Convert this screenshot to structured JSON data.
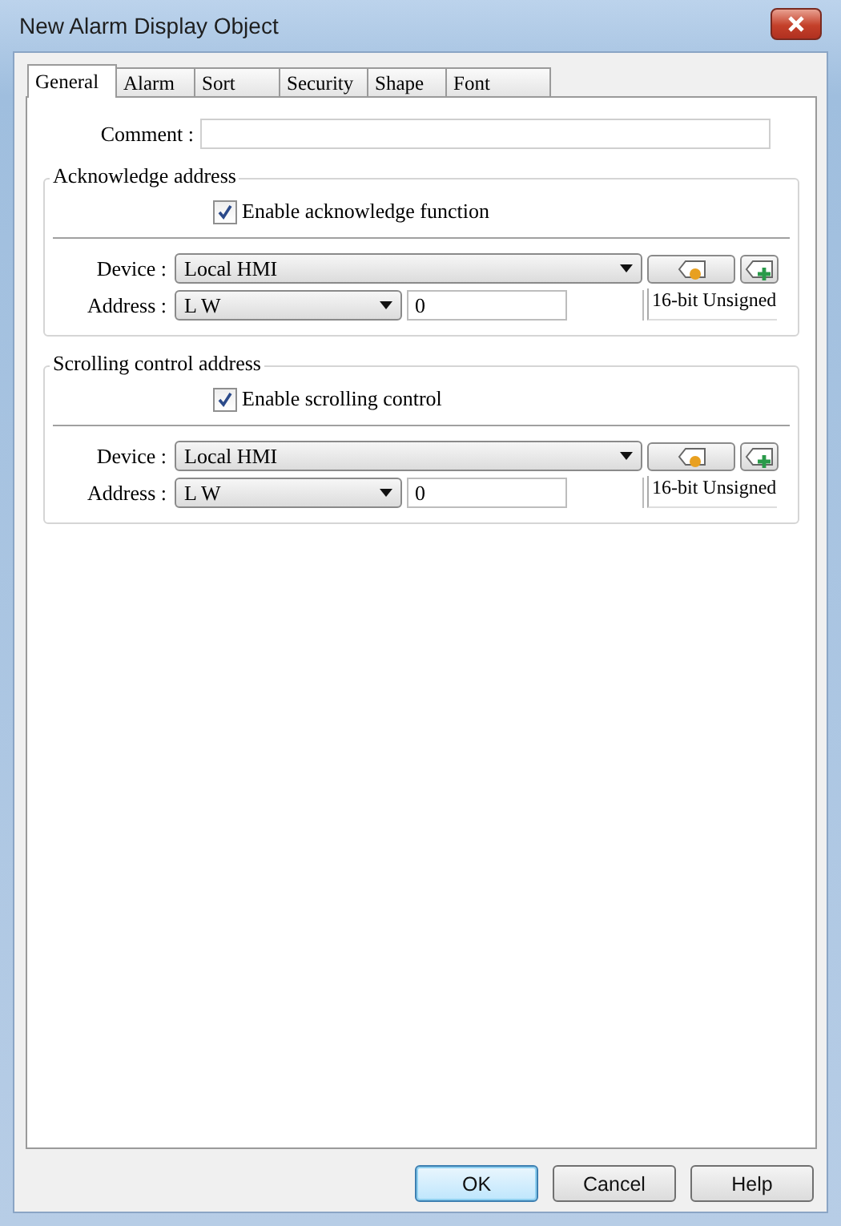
{
  "window": {
    "title": "New Alarm Display Object"
  },
  "tabs": [
    {
      "label": "General",
      "selected": true
    },
    {
      "label": "Alarm",
      "selected": false
    },
    {
      "label": "Sort",
      "selected": false
    },
    {
      "label": "Security",
      "selected": false
    },
    {
      "label": "Shape",
      "selected": false
    },
    {
      "label": "Font",
      "selected": false
    }
  ],
  "comment": {
    "label": "Comment :"
  },
  "sections": [
    {
      "title": "Acknowledge address",
      "checkbox": {
        "label": "Enable acknowledge function",
        "checked": true
      },
      "device": {
        "label": "Device :",
        "value": "Local HMI"
      },
      "address": {
        "label": "Address :",
        "register": "L W",
        "value": "0",
        "type": "16-bit Unsigned"
      }
    },
    {
      "title": "Scrolling control address",
      "checkbox": {
        "label": "Enable scrolling control",
        "checked": true
      },
      "device": {
        "label": "Device :",
        "value": "Local HMI"
      },
      "address": {
        "label": "Address :",
        "register": "L W",
        "value": "0",
        "type": "16-bit Unsigned"
      }
    }
  ],
  "buttons": [
    {
      "label": "OK",
      "default": true
    },
    {
      "label": "Cancel",
      "default": false
    },
    {
      "label": "Help",
      "default": false
    }
  ]
}
